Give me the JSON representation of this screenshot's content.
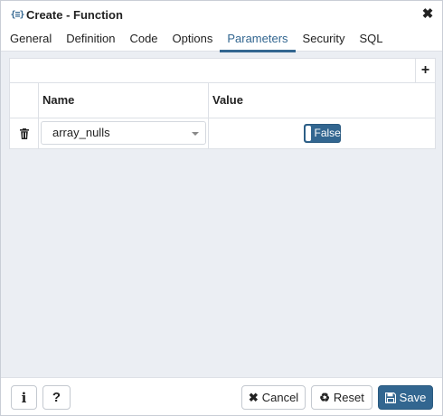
{
  "window": {
    "title": "Create - Function",
    "title_icon": "{≡}",
    "close_glyph": "✖"
  },
  "tabs": [
    {
      "label": "General",
      "active": false
    },
    {
      "label": "Definition",
      "active": false
    },
    {
      "label": "Code",
      "active": false
    },
    {
      "label": "Options",
      "active": false
    },
    {
      "label": "Parameters",
      "active": true
    },
    {
      "label": "Security",
      "active": false
    },
    {
      "label": "SQL",
      "active": false
    }
  ],
  "grid": {
    "add_glyph": "+",
    "columns": {
      "name": "Name",
      "value": "Value"
    },
    "rows": [
      {
        "delete_glyph": "🗑",
        "name": "array_nulls",
        "value": "False"
      }
    ]
  },
  "footer": {
    "info_label": "i",
    "help_label": "?",
    "cancel_icon": "✖",
    "cancel_label": "Cancel",
    "reset_icon": "♻",
    "reset_label": "Reset",
    "save_icon": "🖫",
    "save_label": "Save"
  },
  "colors": {
    "accent": "#326690",
    "background": "#ebeef3"
  }
}
